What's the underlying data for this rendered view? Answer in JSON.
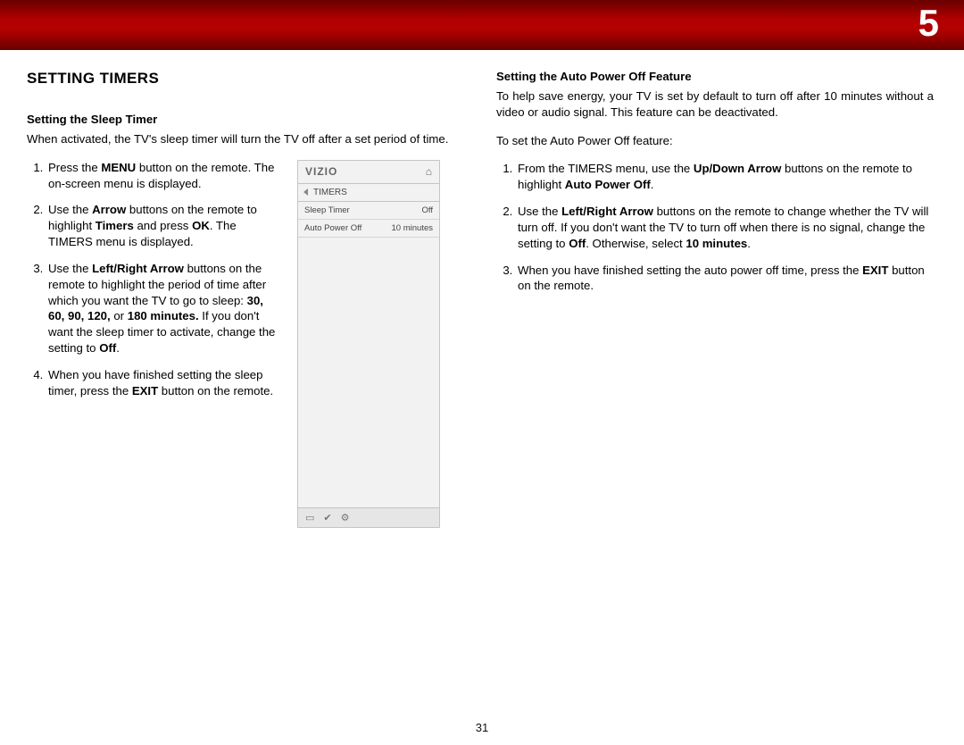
{
  "banner": {
    "number": "5"
  },
  "page_number": "31",
  "left_col": {
    "section_title": "SETTING TIMERS",
    "sleep_title": "Setting the Sleep Timer",
    "sleep_intro": "When activated, the TV's sleep timer will turn the TV off after a set period of time.",
    "step1_a": "Press the ",
    "step1_b_bold": "MENU",
    "step1_c": " button on the remote. The on-screen menu is displayed.",
    "step2_a": "Use the ",
    "step2_b_bold": "Arrow",
    "step2_c": " buttons on the remote to highlight ",
    "step2_d_bold": "Timers",
    "step2_e": " and press ",
    "step2_f_bold": "OK",
    "step2_g": ". The TIMERS menu is displayed.",
    "step3_a": "Use the ",
    "step3_b_bold": "Left/Right Arrow",
    "step3_c": " buttons on the remote to highlight the period of time after which you want the TV to go to sleep: ",
    "step3_d_bold": "30, 60, 90, 120,",
    "step3_e": " or ",
    "step3_f_bold": "180 minutes.",
    "step3_g": " If you don't want the sleep timer to activate, change the setting to ",
    "step3_h_bold": "Off",
    "step3_i": ".",
    "step4_a": "When you have finished setting the sleep timer, press the ",
    "step4_b_bold": "EXIT",
    "step4_c": " button on the remote."
  },
  "menu": {
    "logo": "VIZIO",
    "home_icon": "⌂",
    "crumb": "TIMERS",
    "row1_label": "Sleep Timer",
    "row1_value": "Off",
    "row2_label": "Auto Power Off",
    "row2_value": "10 minutes",
    "foot_icon1": "▭",
    "foot_icon2": "✔",
    "foot_icon3": "⚙"
  },
  "right_col": {
    "auto_title": "Setting the Auto Power Off Feature",
    "auto_intro": "To help save energy, your TV is set by default to turn off after 10 minutes without a video or audio signal. This feature can be deactivated.",
    "auto_lead": "To set the Auto Power Off feature:",
    "r1_a": "From the TIMERS menu, use the ",
    "r1_b_bold": "Up/Down Arrow",
    "r1_c": " buttons on the remote to highlight ",
    "r1_d_bold": "Auto Power Off",
    "r1_e": ".",
    "r2_a": "Use the ",
    "r2_b_bold": "Left/Right Arrow",
    "r2_c": " buttons on the remote to change whether the TV will turn off. If you don't want the TV to turn off when there is no signal, change the setting to ",
    "r2_d_bold": "Off",
    "r2_e": ". Otherwise, select ",
    "r2_f_bold": "10 minutes",
    "r2_g": ".",
    "r3_a": "When you have finished setting the auto power off time, press the ",
    "r3_b_bold": "EXIT",
    "r3_c": " button on the remote."
  }
}
